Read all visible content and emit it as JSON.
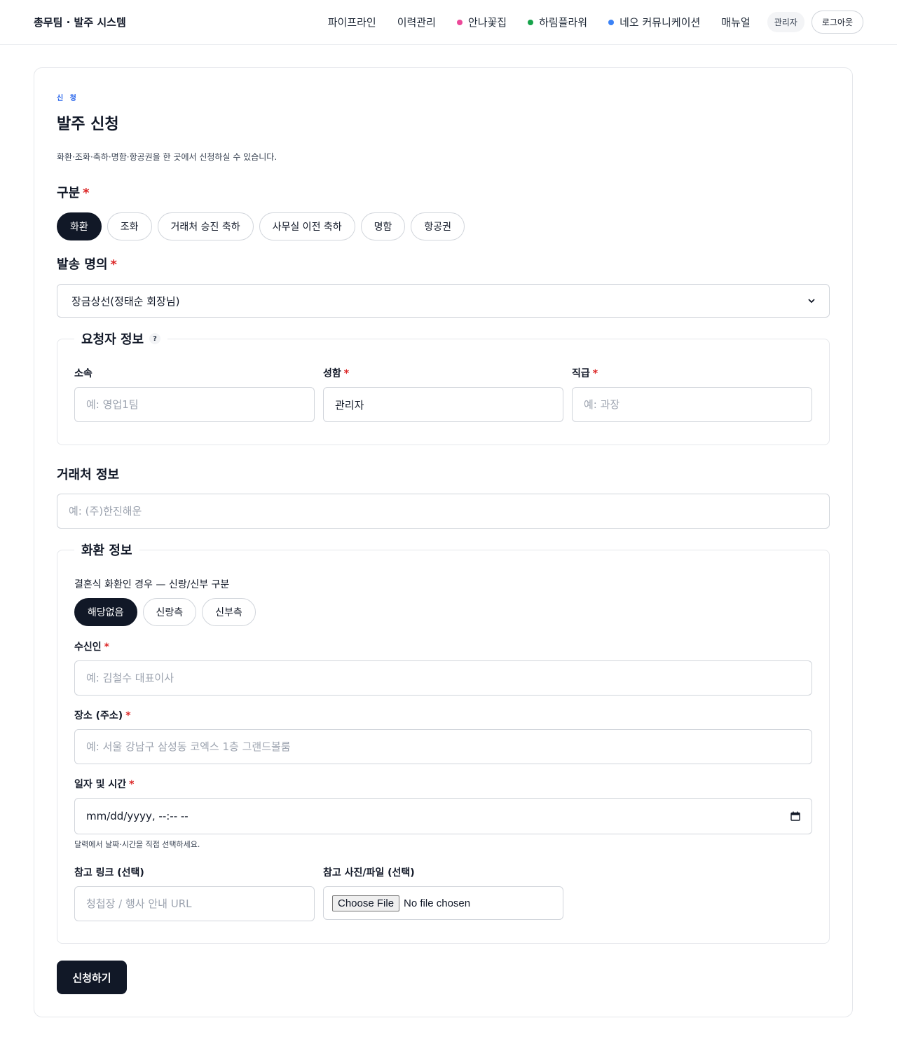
{
  "header": {
    "brand": "총무팀 · 발주 시스템",
    "nav": [
      {
        "label": "파이프라인",
        "dot_color": ""
      },
      {
        "label": "이력관리",
        "dot_color": ""
      },
      {
        "label": "안나꽃집",
        "dot_color": "#ec4899"
      },
      {
        "label": "하림플라워",
        "dot_color": "#16a34a"
      },
      {
        "label": "네오 커뮤니케이션",
        "dot_color": "#3b82f6"
      },
      {
        "label": "매뉴얼",
        "dot_color": ""
      }
    ],
    "admin_badge": "관리자",
    "logout": "로그아웃"
  },
  "form": {
    "eyebrow": "신 청",
    "title": "발주 신청",
    "subtitle": "화환·조화·축하·명함·항공권을 한 곳에서 신청하실 수 있습니다.",
    "category": {
      "label": "구분",
      "required_mark": "*",
      "options": [
        "화환",
        "조화",
        "거래처 승진 축하",
        "사무실 이전 축하",
        "명함",
        "항공권"
      ],
      "selected": "화환"
    },
    "sender": {
      "label": "발송 명의",
      "required_mark": "*",
      "value": "장금상선(정태순 회장님)"
    },
    "requester": {
      "legend": "요청자 정보",
      "help": "?",
      "dept": {
        "label": "소속",
        "placeholder": "예: 영업1팀",
        "value": ""
      },
      "name": {
        "label": "성함",
        "required_mark": "*",
        "placeholder": "",
        "value": "관리자"
      },
      "rank": {
        "label": "직급",
        "required_mark": "*",
        "placeholder": "예: 과장",
        "value": ""
      }
    },
    "client": {
      "label": "거래처 정보",
      "placeholder": "예: (주)한진해운"
    },
    "wreath": {
      "legend": "화환 정보",
      "wedding_label": "결혼식 화환인 경우 — 신랑/신부 구분",
      "wedding_options": [
        "해당없음",
        "신랑측",
        "신부측"
      ],
      "wedding_selected": "해당없음",
      "recipient": {
        "label": "수신인",
        "required_mark": "*",
        "placeholder": "예: 김철수 대표이사"
      },
      "place": {
        "label": "장소 (주소)",
        "required_mark": "*",
        "placeholder": "예: 서울 강남구 삼성동 코엑스 1층 그랜드볼룸"
      },
      "datetime": {
        "label": "일자 및 시간",
        "required_mark": "*",
        "value": "mm/dd/yyyy, --:-- --",
        "hint": "달력에서 날짜·시간을 직접 선택하세요."
      },
      "link": {
        "label": "참고 링크 (선택)",
        "placeholder": "청첩장 / 행사 안내 URL"
      },
      "file": {
        "label": "참고 사진/파일 (선택)",
        "button": "Choose File",
        "status": "No file chosen"
      }
    },
    "submit": "신청하기"
  }
}
